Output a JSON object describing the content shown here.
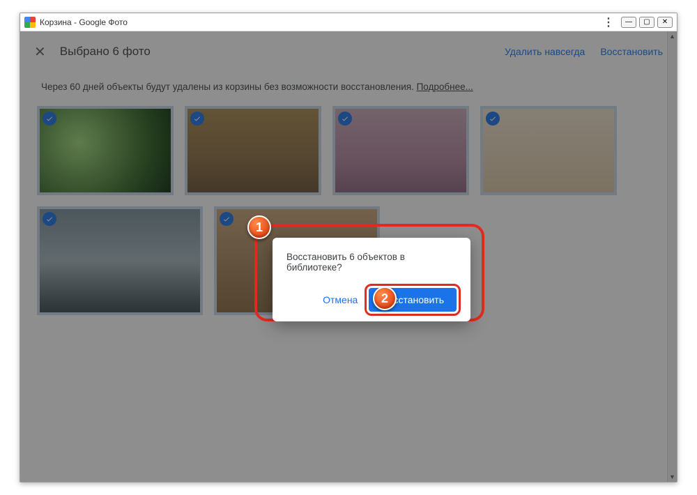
{
  "window": {
    "title": "Корзина - Google Фото",
    "more_icon": "⋮",
    "minimize": "—",
    "maximize": "▢",
    "close": "✕"
  },
  "selection_bar": {
    "close": "✕",
    "text": "Выбрано 6 фото",
    "delete_forever": "Удалить навсегда",
    "restore": "Восстановить"
  },
  "notice": {
    "text": "Через 60 дней объекты будут удалены из корзины без возможности восстановления. ",
    "learn_more": "Подробнее..."
  },
  "dialog": {
    "text": "Восстановить 6 объектов в библиотеке?",
    "cancel": "Отмена",
    "restore": "Восстановить"
  },
  "steps": {
    "one": "1",
    "two": "2"
  },
  "scrollbar": {
    "up": "▲",
    "down": "▼"
  }
}
